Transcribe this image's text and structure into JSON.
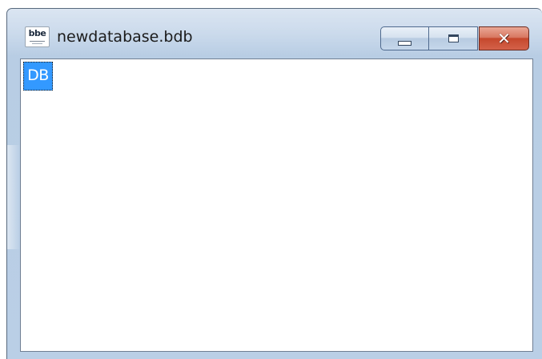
{
  "window": {
    "title": "newdatabase.bdb",
    "app_icon": {
      "name": "bbe-app-icon",
      "text": "bbe"
    },
    "caption_buttons": {
      "minimize_icon": "minimize-icon",
      "maximize_icon": "maximize-icon",
      "close_icon": "close-icon",
      "close_glyph": "✕"
    }
  },
  "content": {
    "items": [
      {
        "label": "DB",
        "selected": true
      }
    ]
  },
  "colors": {
    "selection": "#3399ff",
    "close_button": "#c5472c",
    "frame": "#bacfe6"
  }
}
